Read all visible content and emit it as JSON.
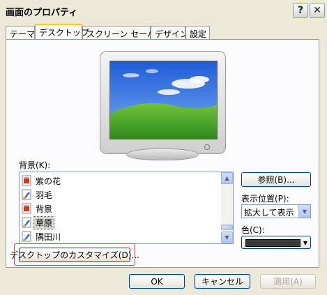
{
  "window": {
    "title": "画面のプロパティ",
    "help_label": "?",
    "close_label": "✕"
  },
  "tabs": [
    {
      "label": "テーマ"
    },
    {
      "label": "デスクトップ"
    },
    {
      "label": "スクリーン セーバー"
    },
    {
      "label": "デザイン"
    },
    {
      "label": "設定"
    }
  ],
  "background": {
    "label": "背景(K):",
    "items": [
      {
        "label": "紫の花",
        "icon": "image-file-icon"
      },
      {
        "label": "羽毛",
        "icon": "bitmap-file-icon"
      },
      {
        "label": "背景",
        "icon": "image-file-icon"
      },
      {
        "label": "草原",
        "icon": "bitmap-file-icon",
        "selected": true
      },
      {
        "label": "隅田川",
        "icon": "bitmap-file-icon"
      }
    ]
  },
  "browse_label": "参照(B)...",
  "position": {
    "label": "表示位置(P):",
    "value": "拡大して表示"
  },
  "color": {
    "label": "色(C):",
    "value": "#3a3a3a"
  },
  "customize_label": "デスクトップのカスタマイズ(D)...",
  "footer": {
    "ok_label": "OK",
    "cancel_label": "キャンセル",
    "apply_label": "適用(A)"
  }
}
